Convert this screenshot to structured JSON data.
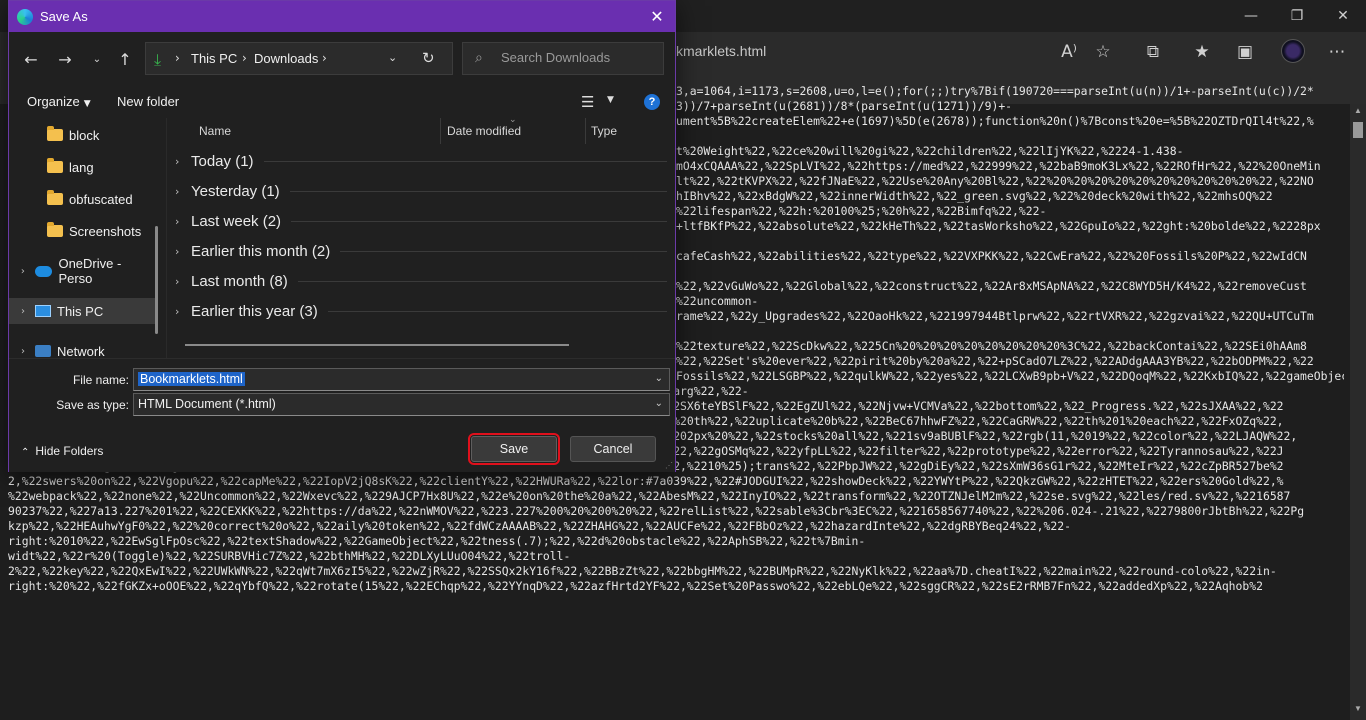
{
  "browser": {
    "address_text": "kmarklets.html",
    "icons": [
      "read-aloud-icon",
      "favorite-add-icon",
      "extensions-icon",
      "favorites-icon",
      "collections-icon",
      "profile-avatar",
      "more-icon"
    ]
  },
  "page_code": [
    "3,a=1064,i=1173,s=2608,u=o,l=e();for(;;)try%7Bif(190720===parseInt(u(n))/1+-parseInt(u(c))/2*",
    "3))/7+parseInt(u(2681))/8*(parseInt(u(1271))/9)+-",
    "ument%5B%22createElem%22+e(1697)%5D(e(2678));function%20n()%7Bconst%20e=%5B%22OZTDrQIl4t%22,%",
    "",
    "t%20Weight%22,%22ce%20will%20gi%22,%22children%22,%22lIjYK%22,%2224-1.438-",
    "mO4xCQAAA%22,%22SpLVI%22,%22https://med%22,%22999%22,%22baB9moK3Lx%22,%22ROfHr%22,%22%20OneMin",
    "lt%22,%22tKVPX%22,%22fJNaE%22,%22Use%20Any%20Bl%22,%22%20%20%20%20%20%20%20%20%20%20%22,%22NO",
    "hIBhv%22,%22xBdgW%22,%22innerWidth%22,%22_green.svg%22,%22%20deck%20with%22,%22mhsOQ%22",
    "%22lifespan%22,%22h:%20100%25;%20h%22,%22Bimfq%22,%22-",
    "+ltfBKfP%22,%22absolute%22,%22kHeTh%22,%22tasWorksho%22,%22GpuIo%22,%22ght:%20bolde%22,%2228px",
    "",
    "cafeCash%22,%22abilities%22,%22type%22,%22VXPKK%22,%22CwEra%22,%22%20Fossils%20P%22,%22wIdCN",
    "",
    "%22,%22vGuWo%22,%22Global%22,%22construct%22,%22Ar8xMSApNA%22,%22C8WYD5H/K4%22,%22removeCust",
    "%22uncommon-",
    "rame%22,%22y_Upgrades%22,%22OaoHk%22,%221997944Btlprw%22,%22rtVXR%22,%22gzvai%22,%22QU+UTCuTm",
    "",
    "%22texture%22,%22ScDkw%22,%225Cn%20%20%20%20%20%20%20%20%3C%22,%22backContai%22,%22SEi0hAAm8",
    "%22,%22Set's%20ever%22,%22pirit%20by%20a%22,%22+pSCadO7LZ%22,%22ADdgAAA3YB%22,%22bODPM%22,%22",
    "Fossils%22,%22LSGBP%22,%22qulkW%22,%22yes%22,%22LCXwB9pb+V%22,%22DQoqM%22,%22KxbIQ%22,%22gameObject%22,%22chroma-",
    "3%22,%22%206px%20rgb(0%22,%22nwCUUpcAj4%22,%22Uudfv%22,%22uyJZT%22,%22CdfrY%22,%2228px%22,%22%20marg%22,%22-",
    "1.613%201.4%22,%22vZjJpA/p5j%22,%22HR1aUwBDx4%22,%22string%22,%22This%20cheat%22,%22respawn%22,%22SX6teYBSlF%22,%22EgZUl%22,%22Njvw+VCMVa%22,%22bottom%22,%22_Progress.%22,%22sJXAA%22,%22",
    "Opens%20a%20bo%22,%22JSxLJ%22,%22Whad7Xf4Qu%22,%22VDPIt%22,%22tanDU%22,%22IjMxb%22,%22o%20be%20on%20th%22,%22uplicate%20b%22,%22BeC67hhwFZ%22,%22CaGRW%22,%22th%201%20each%22,%22FxOZq%22,",
    "%22%20suggested%22,%22FVRTM%22,%22UdqPQ%22,%22rrcq/w99zo%22,%22lCUqL%22,%22rjllx%22,%22%202px%20%202px%20%22,%22stocks%20all%22,%221sv9aBUBlF%22,%22rgb(11,%2019%22,%22color%22,%22LJAQW%22,",
    "%22aJULT%22,%22CNCxf4nuOo%22,%22o%20hide%20%7C%20C%22,%22NVEhg%22,%22jTA4+tyTf0%22,%22/Media/sur%22,%22gOSMq%22,%22yfpLL%22,%22filter%22,%22prototype%22,%22error%22,%22Tyrannosau%22,%22J",
    "Nohu%22,%22weight%22,%22jXOQX%22,%22futureEnem%22,%22isTeam%22,%22/Media/uiT%22,%22Blook%20Rush%22,%2210%25);trans%22,%22PbpJW%22,%22gDiEy%22,%22sXmW36sG1r%22,%22MteIr%22,%22cZpBR527be%2",
    "2,%22swers%20on%22,%22Vgopu%22,%22capMe%22,%22IopV2jQ8sK%22,%22clientY%22,%22HWURa%22,%22lor:#7a039%22,%22#JODGUI%22,%22showDeck%22,%22YWYtP%22,%22QkzGW%22,%22zHTET%22,%22ers%20Gold%22,%",
    "%22webpack%22,%22none%22,%22Uncommon%22,%22Wxevc%22,%229AJCP7Hx8U%22,%22e%20on%20the%20a%22,%22AbesM%22,%22InyIO%22,%22transform%22,%22OTZNJelM2m%22,%22se.svg%22,%22les/red.sv%22,%2216587",
    "90237%22,%227a13.227%201%22,%22CEXKK%22,%22https://da%22,%22nWMOV%22,%223.227%200%20%200%20%22,%22relList%22,%22sable%3Cbr%3EC%22,%221658567740%22,%22%206.024-.21%22,%2279800rJbtBh%22,%22Pg",
    "kzp%22,%22HEAuhwYgF0%22,%22%20correct%20o%22,%22aily%20token%22,%22fdWCzAAAAB%22,%22ZHAHG%22,%22AUCFe%22,%22FBbOz%22,%22hazardInte%22,%22dgRBYBeq24%22,%22-",
    "right:%2010%22,%22EwSglFpOsc%22,%22textShadow%22,%22GameObject%22,%22tness(.7);%22,%22d%20obstacle%22,%22AphSB%22,%22t%7Bmin-",
    "widt%22,%22r%20(Toggle)%22,%22SURBVHic7Z%22,%22bthMH%22,%22DLXyLUuO04%22,%22troll-",
    "2%22,%22key%22,%22QxEwI%22,%22UWkWN%22,%22qWt7mX6zI5%22,%22wZjR%22,%22SSQx2kY16f%22,%22BBzZt%22,%22bbgHM%22,%22BUMpR%22,%22NyKlk%22,%22aa%7D.cheatI%22,%22main%22,%22round-colo%22,%22in-",
    "right:%20%22,%22fGKZx+oOOE%22,%22qYbfQ%22,%22rotate(15%22,%22EChqp%22,%22YYnqD%22,%22azfHrtd2YF%22,%22Set%20Passwo%22,%22ebLQe%22,%22sggCR%22,%22sE2rRMB7Fn%22,%22addedXp%22,%22Aqhob%2"
  ],
  "dialog": {
    "title": "Save As",
    "breadcrumb": [
      "This PC",
      "Downloads"
    ],
    "search_placeholder": "Search Downloads",
    "organize_label": "Organize",
    "new_folder_label": "New folder",
    "help_label": "?",
    "nav_items": [
      {
        "label": "block",
        "type": "folder"
      },
      {
        "label": "lang",
        "type": "folder"
      },
      {
        "label": "obfuscated",
        "type": "folder"
      },
      {
        "label": "Screenshots",
        "type": "folder"
      },
      {
        "label": "OneDrive - Perso",
        "type": "onedrive"
      },
      {
        "label": "This PC",
        "type": "pc",
        "selected": true
      },
      {
        "label": "Network",
        "type": "network"
      }
    ],
    "columns": [
      "Name",
      "Date modified",
      "Type"
    ],
    "groups": [
      "Today (1)",
      "Yesterday (1)",
      "Last week (2)",
      "Earlier this month (2)",
      "Last month (8)",
      "Earlier this year (3)"
    ],
    "file_name_label": "File name:",
    "file_name_value": "Bookmarklets.html",
    "save_as_type_label": "Save as type:",
    "save_as_type_value": "HTML Document (*.html)",
    "hide_folders_label": "Hide Folders",
    "save_label": "Save",
    "cancel_label": "Cancel",
    "accent_color": "#6a2fb0",
    "highlight_color": "#e0101c"
  }
}
